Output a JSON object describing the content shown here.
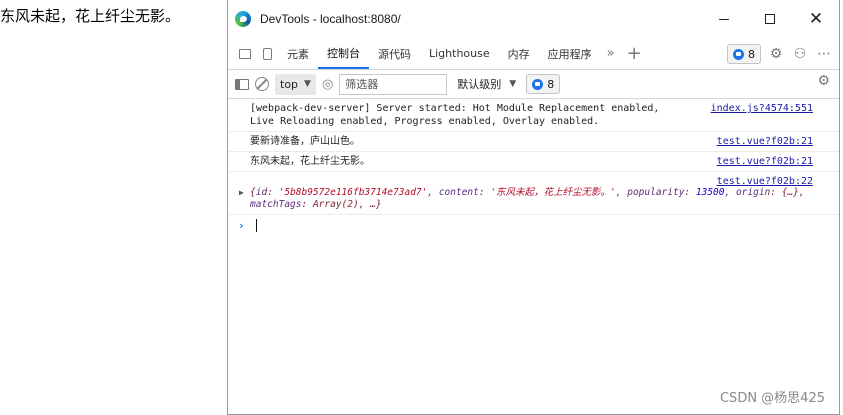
{
  "page": {
    "text": "东风未起，花上纤尘无影。"
  },
  "window": {
    "title": "DevTools - localhost:8080/"
  },
  "tabs": [
    {
      "label": "元素"
    },
    {
      "label": "控制台",
      "active": true
    },
    {
      "label": "源代码"
    },
    {
      "label": "Lighthouse"
    },
    {
      "label": "内存"
    },
    {
      "label": "应用程序"
    }
  ],
  "tabbar": {
    "issues_count": "8"
  },
  "console_toolbar": {
    "context": "top",
    "filter_placeholder": "筛选器",
    "levels": "默认级别",
    "issues_count": "8"
  },
  "logs": [
    {
      "message": "[webpack-dev-server] Server started: Hot Module Replacement enabled, Live Reloading enabled, Progress enabled, Overlay enabled.",
      "source": "index.js?4574:551"
    },
    {
      "message": "要新诗准备，庐山山色。",
      "source": "test.vue?f02b:21"
    },
    {
      "message": "东风未起，花上纤尘无影。",
      "source": "test.vue?f02b:21"
    },
    {
      "source": "test.vue?f02b:22",
      "object": {
        "open": "{",
        "k_id": "id",
        "v_id": "'5b8b9572e116fb3714e73ad7'",
        "k_content": "content",
        "v_content": "'东风未起，花上纤尘无影。'",
        "k_popularity": "popularity",
        "v_popularity": "13500",
        "k_origin": "origin",
        "v_origin": "{…}",
        "k_tags": "matchTags",
        "v_tags": "Array(2)",
        "tail": "…}"
      }
    }
  ],
  "watermark": "CSDN @杨思425",
  "colors": {
    "accent": "#1a73e8",
    "link": "#1a1aa6"
  },
  "icons": [
    "edge-logo-icon",
    "inspect-icon",
    "device-icon",
    "more-tabs-icon",
    "add-tab-icon",
    "settings-icon",
    "customize-icon",
    "menu-icon",
    "sidebar-icon",
    "clear-console-icon",
    "eye-icon",
    "prompt-chevron-icon"
  ]
}
